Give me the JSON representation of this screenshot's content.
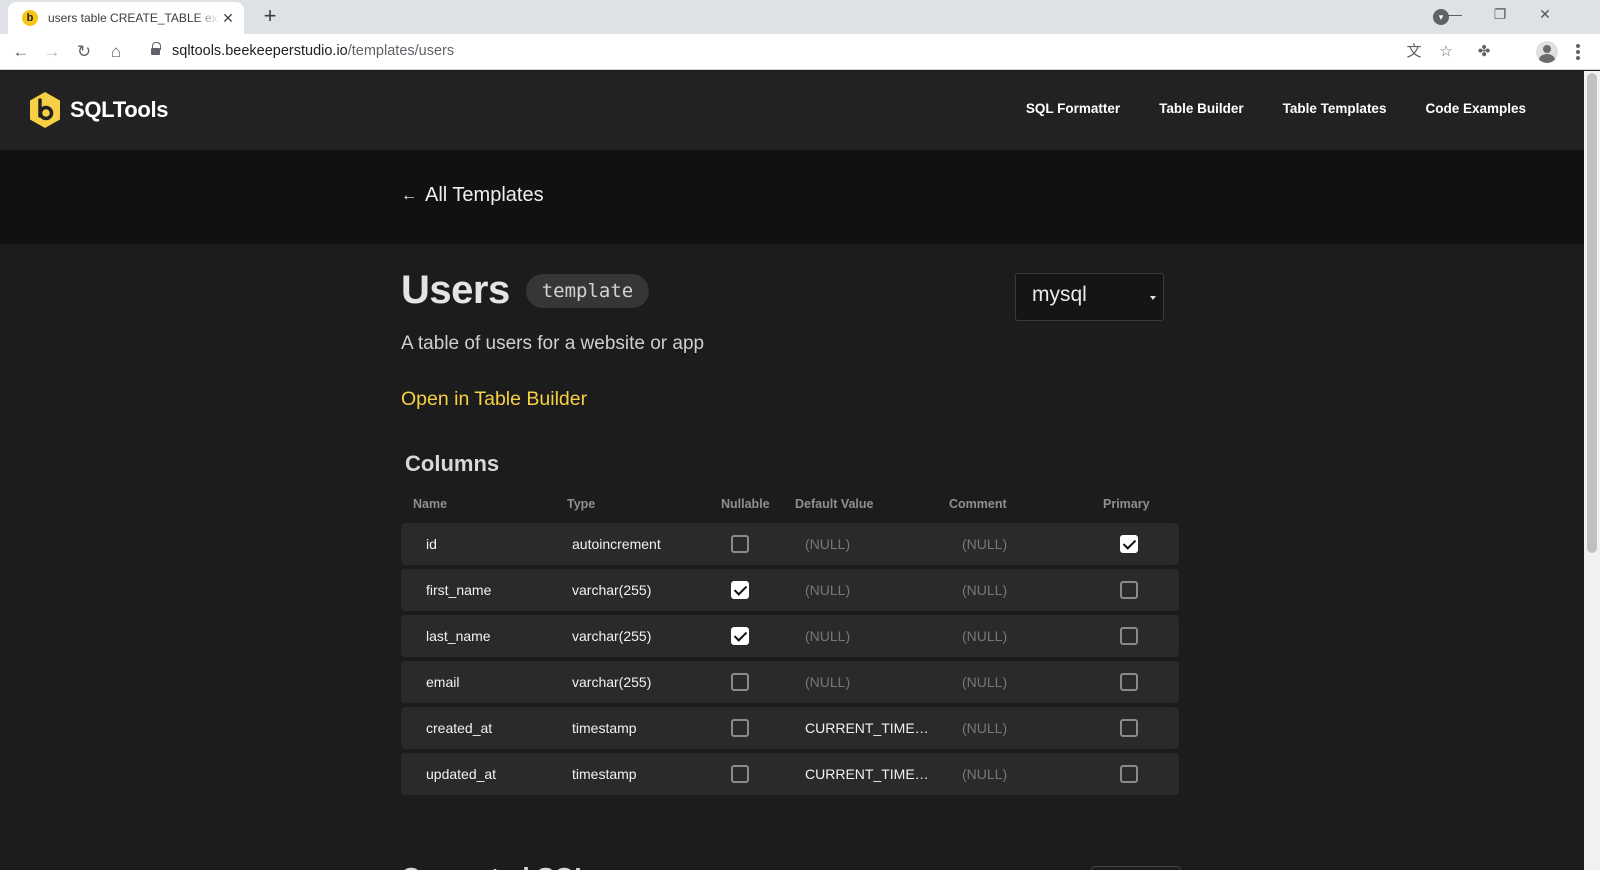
{
  "browser": {
    "tab_title": "users table CREATE_TABLE example",
    "tab_favicon_letter": "b",
    "url_host": "sqltools.beekeeperstudio.io",
    "url_path": "/templates/users"
  },
  "site": {
    "brand": "SQLTools",
    "brand_color": "#f7d046",
    "nav": [
      "SQL Formatter",
      "Table Builder",
      "Table Templates",
      "Code Examples"
    ]
  },
  "hero": {
    "back_label": "All Templates"
  },
  "template": {
    "title": "Users",
    "badge": "template",
    "description": "A table of users for a website or app",
    "open_link": "Open in Table Builder",
    "dialect": "mysql"
  },
  "columns": {
    "section_title": "Columns",
    "headers": [
      "Name",
      "Type",
      "Nullable",
      "Default Value",
      "Comment",
      "Primary"
    ],
    "rows": [
      {
        "name": "id",
        "type": "autoincrement",
        "nullable": false,
        "default": "(NULL)",
        "comment": "(NULL)",
        "primary": true
      },
      {
        "name": "first_name",
        "type": "varchar(255)",
        "nullable": true,
        "default": "(NULL)",
        "comment": "(NULL)",
        "primary": false
      },
      {
        "name": "last_name",
        "type": "varchar(255)",
        "nullable": true,
        "default": "(NULL)",
        "comment": "(NULL)",
        "primary": false
      },
      {
        "name": "email",
        "type": "varchar(255)",
        "nullable": false,
        "default": "(NULL)",
        "comment": "(NULL)",
        "primary": false
      },
      {
        "name": "created_at",
        "type": "timestamp",
        "nullable": false,
        "default": "CURRENT_TIMESTAMP",
        "comment": "(NULL)",
        "primary": false
      },
      {
        "name": "updated_at",
        "type": "timestamp",
        "nullable": false,
        "default": "CURRENT_TIMESTAMP",
        "comment": "(NULL)",
        "primary": false
      }
    ]
  },
  "next_section": {
    "title": "Generated SQL"
  }
}
